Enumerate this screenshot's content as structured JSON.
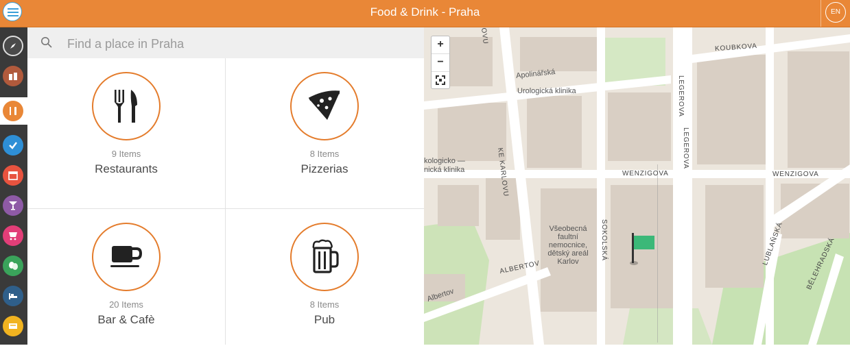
{
  "header": {
    "title": "Food & Drink - Praha",
    "language": "EN"
  },
  "colors": {
    "accent": "#e98737",
    "sidebar": "#3a3a3a"
  },
  "sidebar": {
    "items": [
      {
        "icon": "compass-icon",
        "color": "#4a4a4a"
      },
      {
        "icon": "sights-icon",
        "color": "#b15a3c"
      },
      {
        "icon": "fork-knife-icon",
        "color": "#e98737"
      },
      {
        "icon": "checkmark-icon",
        "color": "#2e8fd6"
      },
      {
        "icon": "calendar-icon",
        "color": "#e8533f"
      },
      {
        "icon": "cocktail-icon",
        "color": "#8e5aa6"
      },
      {
        "icon": "cart-icon",
        "color": "#e23e78"
      },
      {
        "icon": "theater-icon",
        "color": "#3aa35b"
      },
      {
        "icon": "bed-icon",
        "color": "#2f5f8a"
      },
      {
        "icon": "ticket-icon",
        "color": "#f1b320"
      }
    ]
  },
  "search": {
    "placeholder": "Find a place in Praha"
  },
  "categories": [
    {
      "count": "9 Items",
      "name": "Restaurants",
      "icon": "fork-knife-icon"
    },
    {
      "count": "8 Items",
      "name": "Pizzerias",
      "icon": "pizza-icon"
    },
    {
      "count": "20 Items",
      "name": "Bar & Cafè",
      "icon": "coffee-cup-icon"
    },
    {
      "count": "8 Items",
      "name": "Pub",
      "icon": "beer-mug-icon"
    }
  ],
  "map": {
    "zoom_in": "+",
    "zoom_out": "−",
    "labels": {
      "apolinarska": "Apolinářská",
      "urologicka": "Urologická klinika",
      "ke_karlovu": "KE KARLOVU",
      "klinika_partial_1": "kologicko —",
      "klinika_partial_2": "nická klinika",
      "legerova_1": "LEGEROVA",
      "legerova_2": "LEGEROVA",
      "koubkova": "KOUBKOVA",
      "wenzigova_1": "WENZIGOVA",
      "wenzigova_2": "WENZIGOVA",
      "hospital_1": "Všeobecná",
      "hospital_2": "faultní",
      "hospital_3": "nemocnice,",
      "hospital_4": "dětský areál",
      "hospital_5": "Karlov",
      "sokolska": "SOKOLSKÁ",
      "albertov_1": "ALBERTOV",
      "albertov_2": "Albertov",
      "lublanska": "LUBLAŇSKÁ",
      "belehradska": "BĚLEHRADSKÁ",
      "ovu": "OVU"
    }
  }
}
